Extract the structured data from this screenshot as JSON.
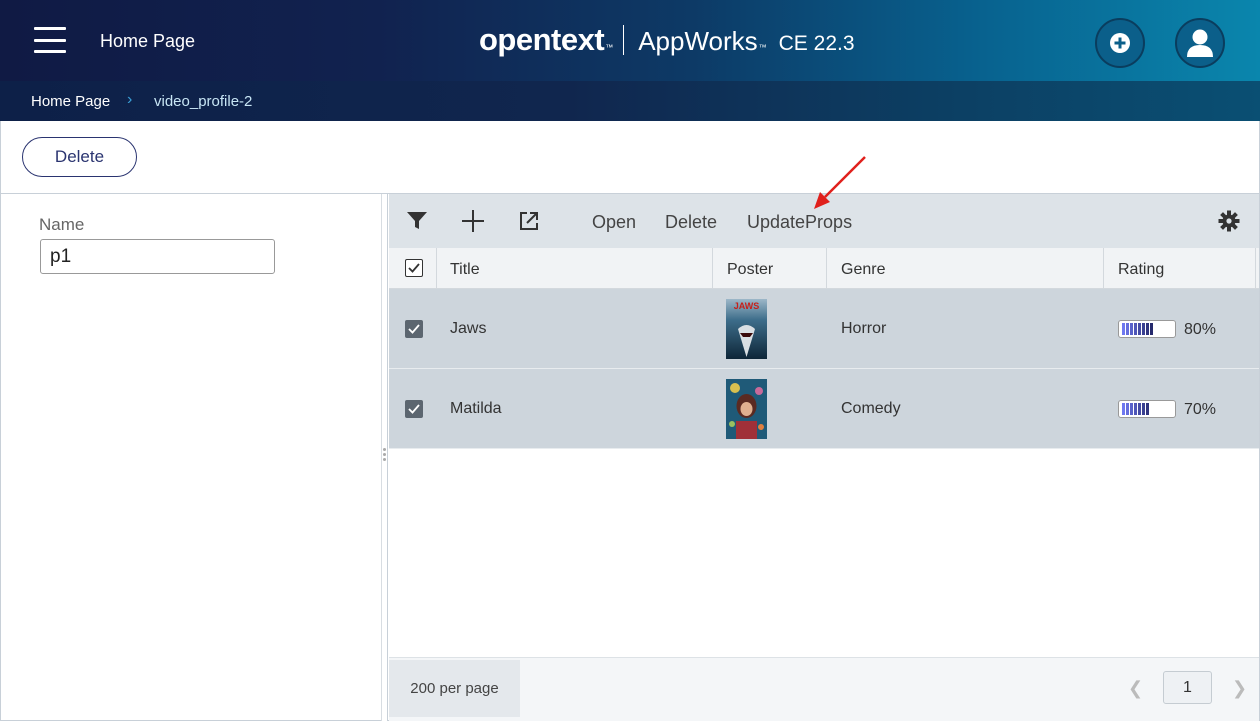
{
  "header": {
    "title": "Home Page",
    "brand_logo": "opentext",
    "brand_tm": "™",
    "brand_app": "AppWorks",
    "brand_app_tm": "™",
    "brand_version": "CE 22.3",
    "menu_icon": "hamburger-menu-icon",
    "add_icon": "plus-circle-icon",
    "user_icon": "user-icon"
  },
  "breadcrumb": {
    "home": "Home Page",
    "separator": "›",
    "current": "video_profile-2"
  },
  "actions": {
    "delete_label": "Delete"
  },
  "form": {
    "name_label": "Name",
    "name_value": "p1"
  },
  "toolbar": {
    "filter_icon": "filter-icon",
    "add_icon": "plus-icon",
    "open_external_icon": "open-external-icon",
    "open_label": "Open",
    "delete_label": "Delete",
    "update_label": "UpdateProps",
    "settings_icon": "gear-icon"
  },
  "grid": {
    "columns": [
      "Title",
      "Poster",
      "Genre",
      "Rating"
    ],
    "rows": [
      {
        "title": "Jaws",
        "genre": "Horror",
        "rating": "80%",
        "rating_value": 80,
        "checked": true,
        "poster_text": "JAWS"
      },
      {
        "title": "Matilda",
        "genre": "Comedy",
        "rating": "70%",
        "rating_value": 70,
        "checked": true,
        "poster_text": ""
      }
    ]
  },
  "footer": {
    "per_page": "200 per page",
    "page": "1",
    "prev_icon": "chevron-left-icon",
    "next_icon": "chevron-right-icon"
  },
  "colors": {
    "header_dark": "#101a44",
    "header_light": "#0a86ad",
    "row_selected": "#cdd5dc",
    "accent": "#2a3470",
    "annotation_arrow": "#e0201c"
  }
}
